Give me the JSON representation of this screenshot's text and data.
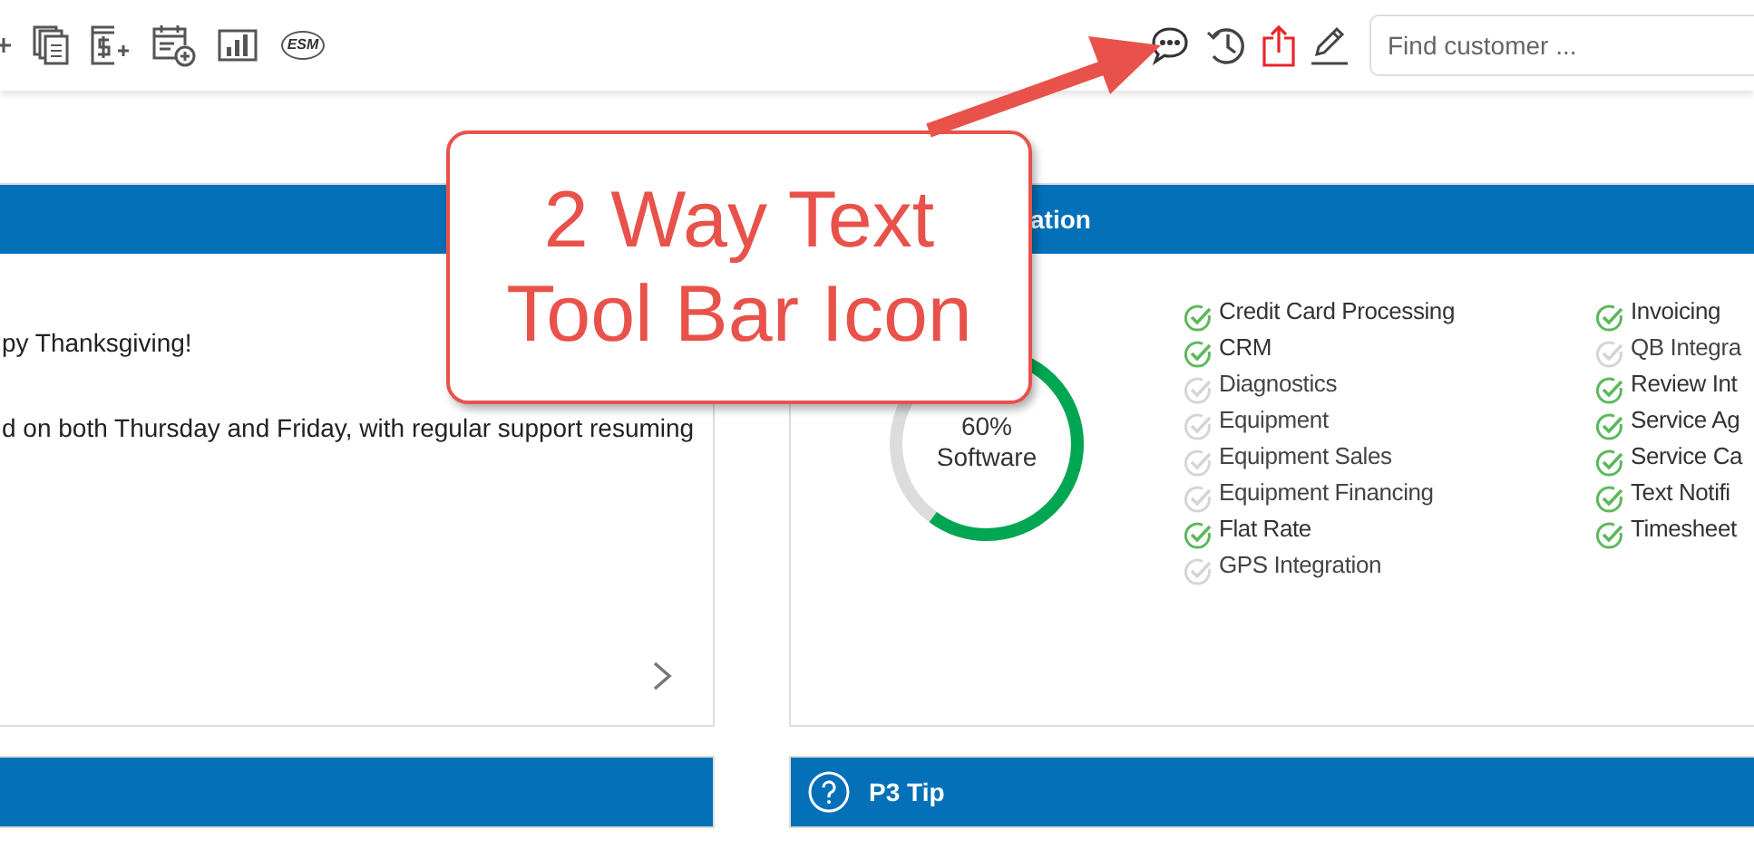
{
  "toolbar": {
    "left_icons": [
      {
        "kind": "plus"
      },
      {
        "kind": "copy"
      },
      {
        "kind": "invoice"
      },
      {
        "kind": "calendar"
      },
      {
        "kind": "chart"
      },
      {
        "kind": "esm",
        "label": "ESM"
      }
    ],
    "right_icons": [
      {
        "kind": "chat"
      },
      {
        "kind": "history"
      },
      {
        "kind": "share"
      },
      {
        "kind": "edit"
      }
    ],
    "search": {
      "placeholder": "Find customer ..."
    }
  },
  "announcement_panel": {
    "lines": [
      "py Thanksgiving!",
      "d on both Thursday and Friday, with regular support resuming"
    ]
  },
  "integration_panel": {
    "title": "ation",
    "donut": {
      "level": 0.6,
      "percent": "60%",
      "label": "Software"
    },
    "columns": [
      [
        {
          "label": "Credit Card Processing",
          "checked": true
        },
        {
          "label": "CRM",
          "checked": true
        },
        {
          "label": "Diagnostics",
          "checked": false
        },
        {
          "label": "Equipment",
          "checked": false
        },
        {
          "label": "Equipment Sales",
          "checked": false
        },
        {
          "label": "Equipment Financing",
          "checked": false
        },
        {
          "label": "Flat Rate",
          "checked": true
        },
        {
          "label": "GPS Integration",
          "checked": false
        }
      ],
      [
        {
          "label": "Invoicing",
          "checked": true
        },
        {
          "label": "QB Integra",
          "checked": false
        },
        {
          "label": "Review Int",
          "checked": true
        },
        {
          "label": "Service Ag",
          "checked": true
        },
        {
          "label": "Service Ca",
          "checked": true
        },
        {
          "label": "Text Notifi",
          "checked": true
        },
        {
          "label": "Timesheet",
          "checked": true
        }
      ]
    ]
  },
  "tip_panel": {
    "title": "P3 Tip"
  },
  "callout": {
    "lines": [
      "2 Way Text",
      "Tool Bar Icon"
    ]
  }
}
